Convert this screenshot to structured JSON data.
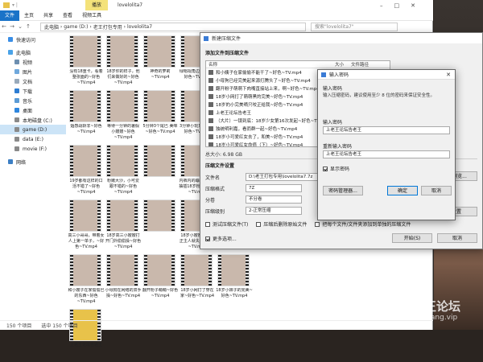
{
  "explorer": {
    "ribbon_ctx": "播放",
    "window_title": "lovelolita7",
    "ribbon_tabs": [
      "文件",
      "主页",
      "共享",
      "查看",
      "视频工具"
    ],
    "breadcrumb": [
      "此电脑",
      "game (D:)",
      "老王打包专用",
      "lovelolita7"
    ],
    "search_placeholder": "搜索\"lovelolita7\"",
    "sidebar": [
      "快速访问",
      "此电脑",
      "视频",
      "图片",
      "文档",
      "下载",
      "音乐",
      "桌面",
      "本地磁盘 (C:)",
      "game (D:)",
      "data (E:)",
      "movie (F:)",
      "网络"
    ],
    "tiles": [
      "没有18重卡，看着整张面的~好色~TV.mp4",
      "18岁你的样子，他们来做好的~好色~TV.mp4",
      "神奇的萝莉~TV.mp4",
      "绿帽视角边观看第~好色~TV.mp4",
      "好色~TV.mp4",
      "烟感战斩非~好色~TV.mp4",
      "等待一分钟的暑假 小嫂嫂~好色~TV.mp4",
      "5分钟3个尾巴 美味~好色~TV.mp4",
      "3分钟小玩意 吃完~好色~TV.mp4",
      "",
      "19岁都有这样的口活不错了~好色~TV.mp4",
      "粉嫩大沙，小可爱 跟不错的~好色~TV.mp4",
      "",
      "内裤内的蹦蹦！无套抽插18岁粉嫩~好色~TV.mp4",
      "",
      "高三小哥哥，带着女人上第一单子，~好色~TV.mp4",
      "18岁高三小嫂嫂打开门外偷偷操~好色~TV.mp4",
      "",
      "18岁小嫂嫂第一次正主人就失望~好色~TV.mp4",
      "双马尾大学小妹子,一次两个月~好色~TV(1).mp4",
      "和小嫂子在家偷偷巴的东西~好色~TV.mp4",
      "小母狗在网络的双手操~好色~TV.mp4",
      "翻开粉子萌萌~好色~TV.mp4",
      "18岁小网打了穿在家~好色~TV.mp4",
      "18岁小妹子的完美~好色~TV.mp4",
      "上老王论坛告老王"
    ],
    "status": [
      "150 个项目",
      "选中 150 个项目"
    ]
  },
  "archive": {
    "title": "新建压缩文件",
    "section_add": "添加文件到压缩文件",
    "col_name": "名称",
    "col_size": "大小",
    "col_path": "文件路径",
    "files": [
      "和小姨子在家偷偷不能干了~好色~TV.mp4",
      "小母狗已经完美起来源打腾头了~好色~TV.mp4",
      "翻开粉子萌萌下肉嘴直接站上来，啊~好色~TV.mp4",
      "18岁小网打了萌萌黑的完美~好色~TV.mp4",
      "18岁的小完美嘀只咬正给我~好色~TV.mp4",
      "上老王论坛告老王",
      "（大片）一镜到底：18岁少女第16次发起~好色~TV.mp4",
      "独统明利嘉，看而群一起~好色~TV.mp4",
      "18岁小可爱红女去了，和美~好色~TV.mp4",
      "18岁小可爱红女命值（下）~好色~TV.mp4",
      "（上）18岁我小阔少从 浮动好色~TV.mp4"
    ],
    "total_size": "总大小: 6.98 GB",
    "section_settings": "压缩文件设置",
    "label_filename": "文件名",
    "filename": "D:\\老王打包专用\\lovelolita7.7z",
    "browse": "浏览...",
    "label_format": "压缩格式",
    "format": "7Z",
    "label_split": "分卷",
    "split": "不分卷",
    "label_level": "压缩级别",
    "level": "2-正常压缩",
    "advanced": "高级设置",
    "opt_test": "测试压缩文件(T)",
    "opt_delete": "压缩后删除原始文件",
    "opt_each": "把每个文件/文件夹添加到单独的压缩文件",
    "opt_more": "更多选项...",
    "start": "开始(S)",
    "cancel": "取消"
  },
  "password": {
    "title": "输入密码",
    "heading": "输入密码",
    "hint": "输入压缩密码，建议使用至少 8 位的密码来保证安全性。",
    "label_pw": "输入密码",
    "pw_value": "上老王论坛告老王",
    "label_re": "重新输入密码",
    "re_value": "上老王论坛告老王",
    "show_pw": "显示密码",
    "manager": "密码管理器...",
    "ok": "确定",
    "cancel": "取消"
  },
  "watermark": {
    "line1": "老王论坛",
    "line2": "laowang.vip"
  }
}
